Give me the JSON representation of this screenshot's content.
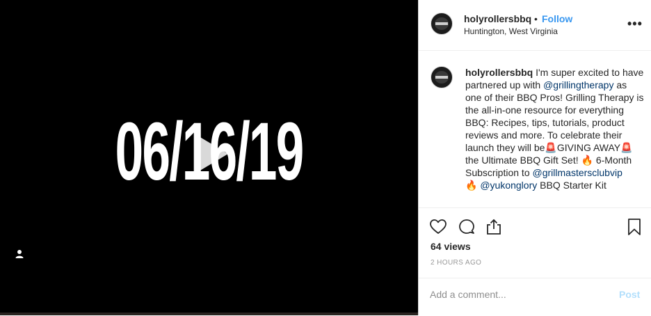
{
  "video": {
    "overlay_text": "06/16/19",
    "play_icon": "play-icon",
    "user_tag_icon": "user-icon"
  },
  "post": {
    "username": "holyrollersbbq",
    "separator": "•",
    "follow_label": "Follow",
    "location": "Huntington, West Virginia",
    "more_icon": "more-options-icon",
    "caption": {
      "username": "holyrollersbbq",
      "part1": " I'm super excited to have partnered up with ",
      "mention1": "@grillingtherapy",
      "part2": " as one of their BBQ Pros! Grilling Therapy is the all-in-one resource for everything BBQ: Recipes, tips, tutorials, product reviews and more. To celebrate their launch they will be",
      "emoji_siren": "🚨",
      "giving_away": "GIVING AWAY",
      "part3": " the Ultimate BBQ Gift Set! ",
      "emoji_fire": "🔥",
      "part4": " 6-Month Subscription to ",
      "mention2": "@grillmastersclubvip",
      "part5": " ",
      "mention3": "@yukonglory",
      "part6": " BBQ Starter Kit"
    },
    "views": "64 views",
    "timestamp": "2 HOURS AGO",
    "comment_placeholder": "Add a comment...",
    "post_label": "Post"
  },
  "colors": {
    "accent": "#3897f0",
    "mention": "#003569",
    "post_disabled": "#b2dffc",
    "video_bg": "#000000"
  }
}
